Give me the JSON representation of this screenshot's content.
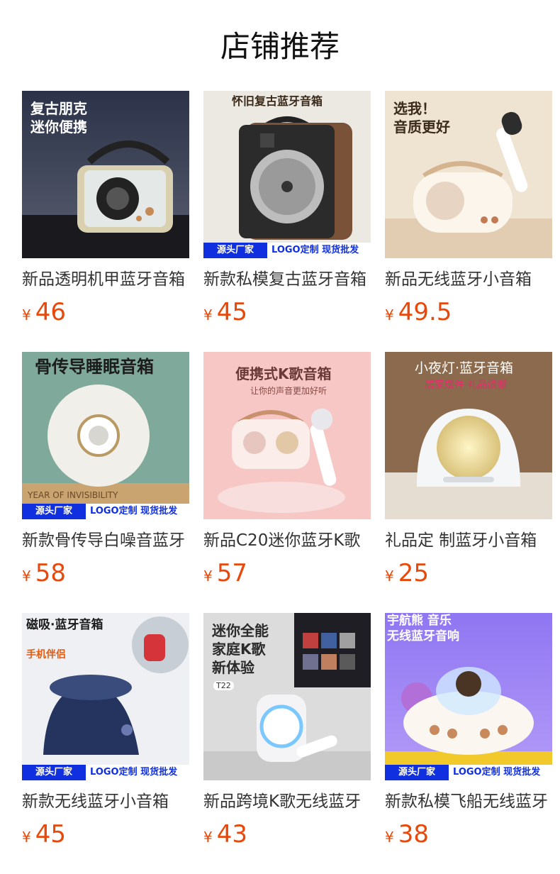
{
  "page": {
    "title": "店铺推荐"
  },
  "currency_symbol": "¥",
  "banner": {
    "source_label": "源头厂家",
    "logo_label": "LOGO定制 现货批发"
  },
  "products": [
    {
      "title": "新品透明机甲蓝牙音箱",
      "price": "46",
      "headline": "复古朋克\n迷你便携",
      "sub": "",
      "has_banner": false,
      "bg": "#3a4258"
    },
    {
      "title": "新款私模复古蓝牙音箱",
      "price": "45",
      "headline": "怀旧复古蓝牙音箱",
      "sub": "",
      "has_banner": true,
      "bg": "#ece8e2"
    },
    {
      "title": "新品无线蓝牙小音箱",
      "price": "49.5",
      "headline": "选我！\n音质更好",
      "sub": "",
      "has_banner": false,
      "bg": "#efe3d2"
    },
    {
      "title": "新款骨传导白噪音蓝牙",
      "price": "58",
      "headline": "骨传导睡眠音箱",
      "sub": "YEAR OF INVISIBILITY",
      "has_banner": true,
      "bg": "#7fa99a"
    },
    {
      "title": "新品C20迷你蓝牙K歌",
      "price": "57",
      "headline": "便携式K歌音箱",
      "sub": "让你的声音更加好听",
      "has_banner": false,
      "bg": "#f6c7c4"
    },
    {
      "title": "礼品定 制蓝牙小音箱",
      "price": "25",
      "headline": "小夜灯·蓝牙音箱",
      "sub": "居家摆件 礼品馈赠",
      "has_banner": false,
      "bg": "#8b6a4e"
    },
    {
      "title": "新款无线蓝牙小音箱",
      "price": "45",
      "headline": "磁吸·蓝牙音箱",
      "sub": "手机伴侣",
      "has_banner": true,
      "bg": "#eef0f3"
    },
    {
      "title": "新品跨境K歌无线蓝牙",
      "price": "43",
      "headline": "迷你全能\n家庭K歌\n新体验",
      "sub": "T22",
      "has_banner": false,
      "bg": "#dcdcdc"
    },
    {
      "title": "新款私模飞船无线蓝牙",
      "price": "38",
      "headline": "宇航熊 音乐\n无线蓝牙音响",
      "sub": "",
      "has_banner": true,
      "bg": "#9a7ff0"
    }
  ]
}
